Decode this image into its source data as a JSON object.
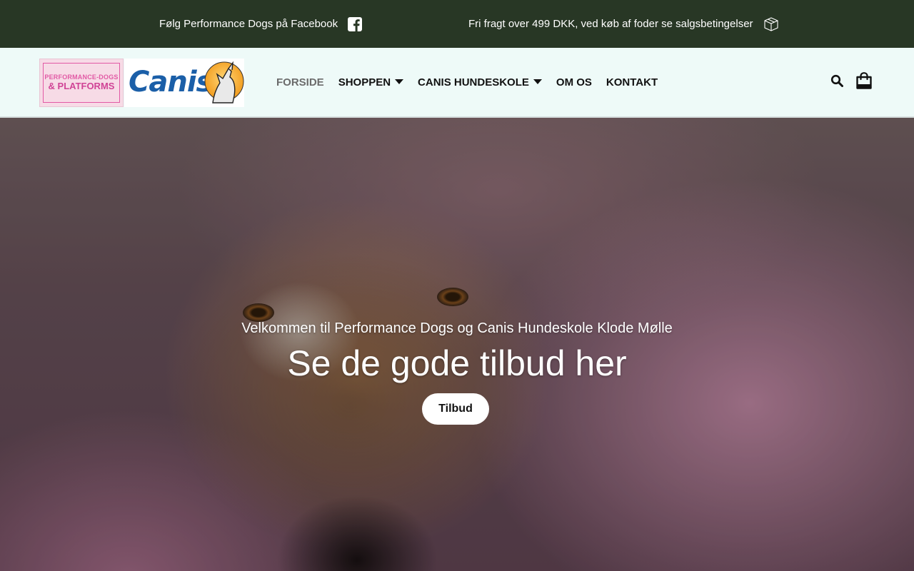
{
  "topbar": {
    "facebook_text": "Følg Performance Dogs på Facebook",
    "shipping_text": "Fri fragt over 499 DKK, ved køb af foder se salgsbetingelser",
    "facebook_icon": "facebook-square-icon",
    "shipping_icon": "box-icon",
    "background_color": "#283725"
  },
  "header": {
    "logo_performance": {
      "line1": "PERFORMANCE-DOGS",
      "line2": "& PLATFORMS"
    },
    "logo_canis": {
      "word": "Canis"
    },
    "background_color": "#eefaf8"
  },
  "nav": {
    "items": [
      {
        "label": "FORSIDE",
        "active": true,
        "dropdown": false
      },
      {
        "label": "SHOPPEN",
        "active": false,
        "dropdown": true
      },
      {
        "label": "CANIS HUNDESKOLE",
        "active": false,
        "dropdown": true
      },
      {
        "label": "OM OS",
        "active": false,
        "dropdown": false
      },
      {
        "label": "KONTAKT",
        "active": false,
        "dropdown": false
      }
    ]
  },
  "header_icons": {
    "search": "search-icon",
    "cart": "shopping-bag-icon"
  },
  "hero": {
    "subtitle": "Velkommen til Performance Dogs og Canis Hundeskole Klode Mølle",
    "title": "Se de gode tilbud her",
    "button_label": "Tilbud"
  }
}
